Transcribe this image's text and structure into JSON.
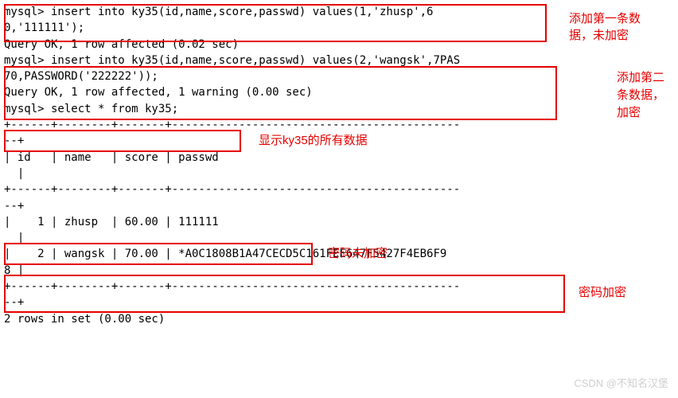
{
  "terminal": {
    "line1": "mysql> insert into ky35(id,name,score,passwd) values(1,'zhusp',6",
    "line2": "0,'111111');",
    "line3": "Query OK, 1 row affected (0.02 sec)",
    "blank1": "",
    "line4": "mysql> insert into ky35(id,name,score,passwd) values(2,'wangsk',7PAS",
    "line5": "70,PASSWORD('222222'));",
    "line6": "Query OK, 1 row affected, 1 warning (0.00 sec)",
    "blank2": "",
    "line7": "mysql> select * from ky35;",
    "line8": "+------+--------+-------+-------------------------------------------",
    "line9": "--+",
    "line10": "| id   | name   | score | passwd",
    "line11": "  |",
    "line12": "+------+--------+-------+-------------------------------------------",
    "line13": "--+",
    "line14": "|    1 | zhusp  | 60.00 | 111111",
    "line15": "  |",
    "line16": "|    2 | wangsk | 70.00 | *A0C1808B1A47CECD5C161FEE647F5427F4EB6F9",
    "line17": "8 |",
    "line18": "+------+--------+-------+-------------------------------------------",
    "line19": "--+",
    "line20": "2 rows in set (0.00 sec)"
  },
  "labels": {
    "a1": "添加第一条数",
    "a2": "据，未加密",
    "b1": "添加第二",
    "b2": "条数据，",
    "b3": "加密",
    "c": "显示ky35的所有数据",
    "d": "密码未加密",
    "e": "密码加密"
  },
  "watermark": "CSDN @不知名汉堡",
  "chart_data": {
    "type": "table",
    "title": "ky35",
    "columns": [
      "id",
      "name",
      "score",
      "passwd"
    ],
    "rows": [
      {
        "id": 1,
        "name": "zhusp",
        "score": 60.0,
        "passwd": "111111"
      },
      {
        "id": 2,
        "name": "wangsk",
        "score": 70.0,
        "passwd": "*A0C1808B1A47CECD5C161FEE647F5427F4EB6F98"
      }
    ]
  }
}
